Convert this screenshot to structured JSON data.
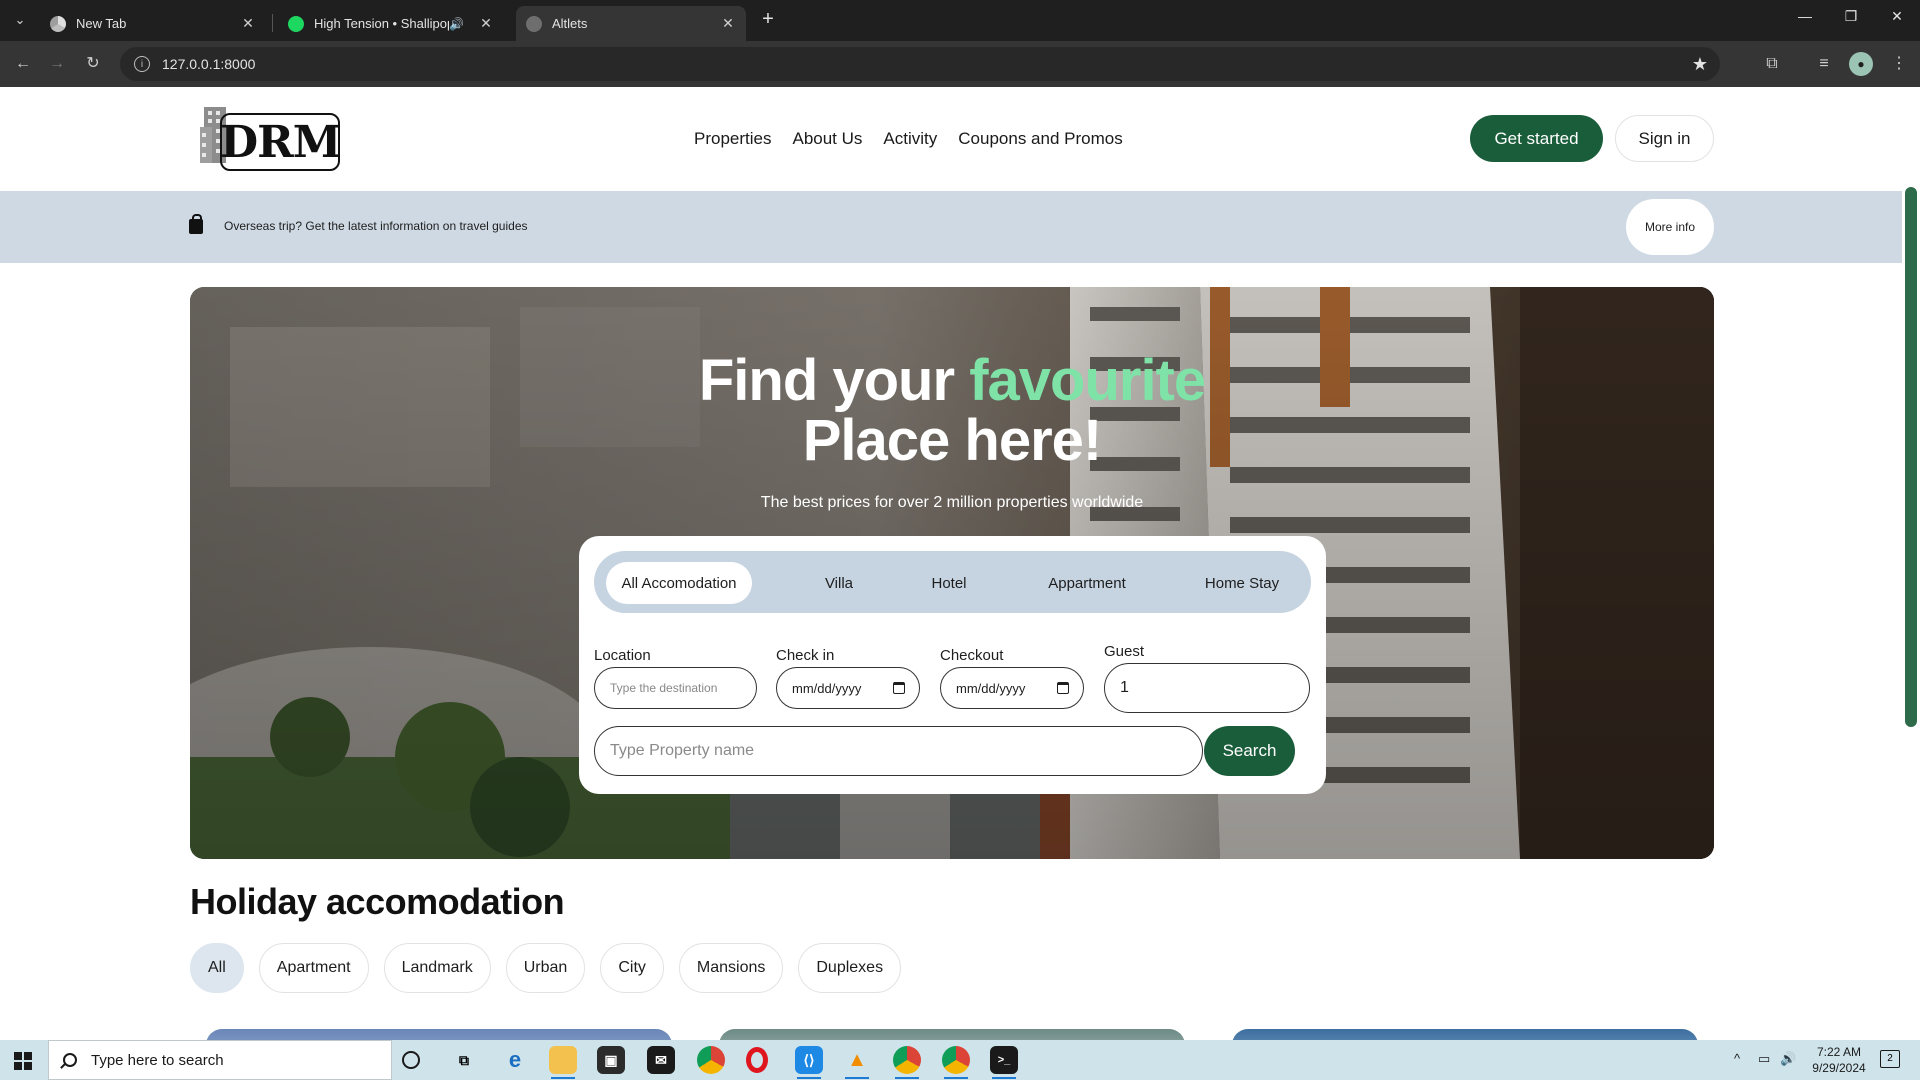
{
  "browser": {
    "tabs": [
      {
        "title": "New Tab",
        "icon": "chrome-icon"
      },
      {
        "title": "High Tension • Shallipopi",
        "icon": "spotify-icon"
      },
      {
        "title": "Altlets",
        "icon": "globe-icon"
      }
    ],
    "url": "127.0.0.1:8000"
  },
  "site": {
    "logo_text": "DRM",
    "nav": [
      "Properties",
      "About Us",
      "Activity",
      "Coupons and Promos"
    ],
    "get_started": "Get started",
    "sign_in": "Sign in",
    "notice_text": "Overseas trip? Get the latest information on travel guides",
    "more_info": "More info",
    "hero": {
      "title_1": "Find your ",
      "title_accent": "favourite",
      "title_2": "Place here!",
      "subtitle": "The best prices for over 2 million properties worldwide"
    },
    "search": {
      "tabs": [
        "All Accomodation",
        "Villa",
        "Hotel",
        "Appartment",
        "Home Stay"
      ],
      "active_tab": "All Accomodation",
      "location_label": "Location",
      "location_placeholder": "Type the destination",
      "checkin_label": "Check in",
      "checkin_value": "mm/dd/yyyy",
      "checkout_label": "Checkout",
      "checkout_value": "mm/dd/yyyy",
      "guest_label": "Guest",
      "guest_value": "1",
      "property_placeholder": "Type Property name",
      "search_button": "Search"
    },
    "section_title": "Holiday accomodation",
    "categories": [
      "All",
      "Apartment",
      "Landmark",
      "Urban",
      "City",
      "Mansions",
      "Duplexes"
    ],
    "active_category": "All"
  },
  "taskbar": {
    "search_placeholder": "Type here to search",
    "time": "7:22 AM",
    "date": "9/29/2024",
    "notification_count": "2"
  },
  "colors": {
    "brand_green": "#1a5d3a",
    "accent_green": "#7fe3a8",
    "notice_bg": "#cfd9e3"
  }
}
